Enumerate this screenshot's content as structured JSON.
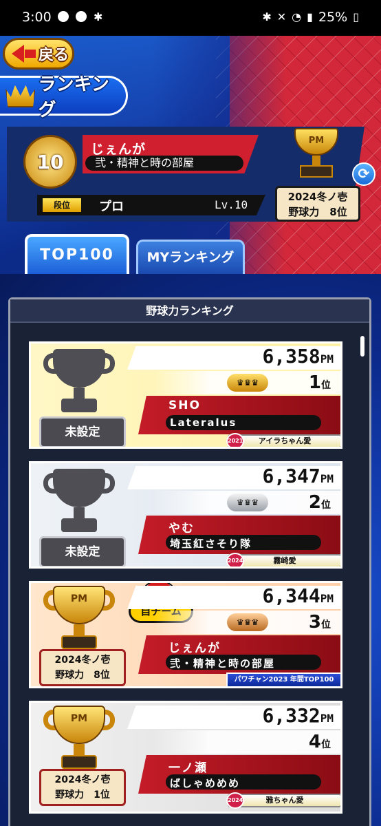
{
  "status": {
    "time": "3:00",
    "battery": "25%"
  },
  "header": {
    "back_label": "戻る",
    "title": "ランキング"
  },
  "profile": {
    "rank_level": "10",
    "name": "じぇんが",
    "team": "弐・精神と時の部屋",
    "dan_label": "段位",
    "dan_value": "プロ",
    "level": "Lv.10",
    "season_line1": "2024冬ノ壱",
    "season_line2": "野球力　8位",
    "trophy_text": "PM"
  },
  "tabs": [
    {
      "label": "TOP100"
    },
    {
      "label": "MYランキング"
    }
  ],
  "panel": {
    "title": "野球力ランキング"
  },
  "rows": [
    {
      "score": "6,358",
      "unit": "PM",
      "rank": "1",
      "rank_suffix": "位",
      "name": "SHO",
      "team": "Lateralus",
      "badge_year": "2021",
      "title": "アイラちゃん愛",
      "left_label": "未設定",
      "bg": "#fff6c0"
    },
    {
      "score": "6,347",
      "unit": "PM",
      "rank": "2",
      "rank_suffix": "位",
      "name": "やむ",
      "team": "埼玉紅さそり隊",
      "badge_year": "2024",
      "title": "霧崎愛",
      "left_label": "未設定",
      "bg": "#dfe6ef"
    },
    {
      "score": "6,344",
      "unit": "PM",
      "rank": "3",
      "rank_suffix": "位",
      "name": "じぇんが",
      "team": "弐・精神と時の部屋",
      "title": "パワチャン2023 年間TOP100",
      "season_line1": "2024冬ノ壱",
      "season_line2": "野球力　8位",
      "my_team": "自チーム",
      "bg": "#ffd8b8"
    },
    {
      "score": "6,332",
      "unit": "PM",
      "rank": "4",
      "rank_suffix": "位",
      "name": "一ノ瀬",
      "team": "ばしゃめめめ",
      "badge_year": "2024",
      "title": "雅ちゃん愛",
      "season_line1": "2024冬ノ壱",
      "season_line2": "野球力　1位",
      "bg": "#e6e6e6"
    }
  ]
}
